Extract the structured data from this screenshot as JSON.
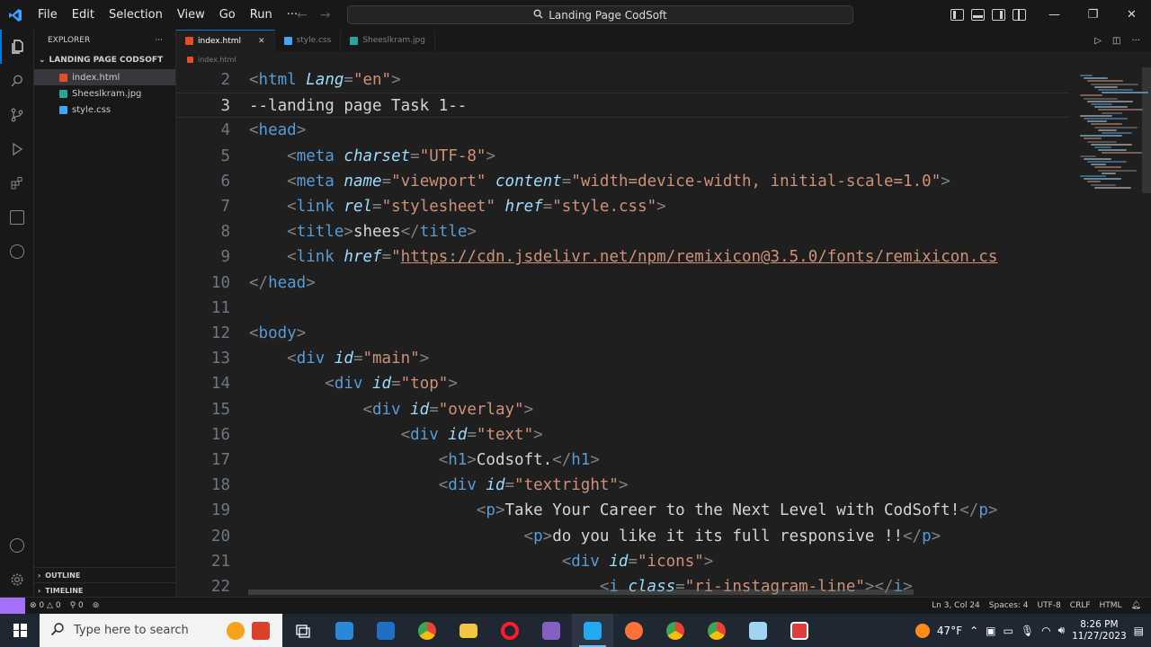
{
  "window": {
    "menu": [
      "File",
      "Edit",
      "Selection",
      "View",
      "Go",
      "Run",
      "···"
    ],
    "search_title": "Landing Page CodSoft"
  },
  "explorer": {
    "title": "EXPLORER",
    "more": "···",
    "folder": "LANDING PAGE CODSOFT",
    "files": [
      {
        "name": "index.html",
        "color": "#e44d26"
      },
      {
        "name": "Sheeslkram.jpg",
        "color": "#26a69a"
      },
      {
        "name": "style.css",
        "color": "#42a5f5"
      }
    ],
    "outline": "OUTLINE",
    "timeline": "TIMELINE"
  },
  "tabs": [
    {
      "label": "index.html",
      "close": "✕"
    },
    {
      "label": "style.css"
    },
    {
      "label": "Sheeslkram.jpg"
    }
  ],
  "breadcrumb": "index.html",
  "editor": {
    "lines": [
      {
        "n": "2",
        "indent": "",
        "tokens": [
          [
            "p",
            "<"
          ],
          [
            "tag",
            "html"
          ],
          [
            "text",
            " "
          ],
          [
            "attr",
            "Lang"
          ],
          [
            "p",
            "="
          ],
          [
            "str",
            "\"en\""
          ],
          [
            "p",
            ">"
          ]
        ]
      },
      {
        "n": "3",
        "indent": "",
        "current": true,
        "tokens": [
          [
            "text",
            "--landing page Task 1--"
          ]
        ]
      },
      {
        "n": "4",
        "indent": "",
        "tokens": [
          [
            "p",
            "<"
          ],
          [
            "tag",
            "head"
          ],
          [
            "p",
            ">"
          ]
        ]
      },
      {
        "n": "5",
        "indent": "    ",
        "tokens": [
          [
            "p",
            "<"
          ],
          [
            "tag",
            "meta"
          ],
          [
            "text",
            " "
          ],
          [
            "attr",
            "charset"
          ],
          [
            "p",
            "="
          ],
          [
            "str",
            "\"UTF-8\""
          ],
          [
            "p",
            ">"
          ]
        ]
      },
      {
        "n": "6",
        "indent": "    ",
        "tokens": [
          [
            "p",
            "<"
          ],
          [
            "tag",
            "meta"
          ],
          [
            "text",
            " "
          ],
          [
            "attr",
            "name"
          ],
          [
            "p",
            "="
          ],
          [
            "str",
            "\"viewport\""
          ],
          [
            "text",
            " "
          ],
          [
            "attr",
            "content"
          ],
          [
            "p",
            "="
          ],
          [
            "str",
            "\"width=device-width, initial-scale=1.0\""
          ],
          [
            "p",
            ">"
          ]
        ]
      },
      {
        "n": "7",
        "indent": "    ",
        "tokens": [
          [
            "p",
            "<"
          ],
          [
            "tag",
            "link"
          ],
          [
            "text",
            " "
          ],
          [
            "attr",
            "rel"
          ],
          [
            "p",
            "="
          ],
          [
            "str",
            "\"stylesheet\""
          ],
          [
            "text",
            " "
          ],
          [
            "attr",
            "href"
          ],
          [
            "p",
            "="
          ],
          [
            "str",
            "\"style.css\""
          ],
          [
            "p",
            ">"
          ]
        ]
      },
      {
        "n": "8",
        "indent": "    ",
        "tokens": [
          [
            "p",
            "<"
          ],
          [
            "tag",
            "title"
          ],
          [
            "p",
            ">"
          ],
          [
            "text",
            "shees"
          ],
          [
            "p",
            "</"
          ],
          [
            "tag",
            "title"
          ],
          [
            "p",
            ">"
          ]
        ]
      },
      {
        "n": "9",
        "indent": "    ",
        "tokens": [
          [
            "p",
            "<"
          ],
          [
            "tag",
            "link"
          ],
          [
            "text",
            " "
          ],
          [
            "attr",
            "href"
          ],
          [
            "p",
            "="
          ],
          [
            "str",
            "\""
          ],
          [
            "link",
            "https://cdn.jsdelivr.net/npm/remixicon@3.5.0/fonts/remixicon.cs"
          ]
        ]
      },
      {
        "n": "10",
        "indent": "",
        "tokens": [
          [
            "p",
            "</"
          ],
          [
            "tag",
            "head"
          ],
          [
            "p",
            ">"
          ]
        ]
      },
      {
        "n": "11",
        "indent": "",
        "tokens": []
      },
      {
        "n": "12",
        "indent": "",
        "tokens": [
          [
            "p",
            "<"
          ],
          [
            "tag",
            "body"
          ],
          [
            "p",
            ">"
          ]
        ]
      },
      {
        "n": "13",
        "indent": "    ",
        "tokens": [
          [
            "p",
            "<"
          ],
          [
            "tag",
            "div"
          ],
          [
            "text",
            " "
          ],
          [
            "attr",
            "id"
          ],
          [
            "p",
            "="
          ],
          [
            "str",
            "\"main\""
          ],
          [
            "p",
            ">"
          ]
        ]
      },
      {
        "n": "14",
        "indent": "        ",
        "tokens": [
          [
            "p",
            "<"
          ],
          [
            "tag",
            "div"
          ],
          [
            "text",
            " "
          ],
          [
            "attr",
            "id"
          ],
          [
            "p",
            "="
          ],
          [
            "str",
            "\"top\""
          ],
          [
            "p",
            ">"
          ]
        ]
      },
      {
        "n": "15",
        "indent": "            ",
        "tokens": [
          [
            "p",
            "<"
          ],
          [
            "tag",
            "div"
          ],
          [
            "text",
            " "
          ],
          [
            "attr",
            "id"
          ],
          [
            "p",
            "="
          ],
          [
            "str",
            "\"overlay\""
          ],
          [
            "p",
            ">"
          ]
        ]
      },
      {
        "n": "16",
        "indent": "                ",
        "tokens": [
          [
            "p",
            "<"
          ],
          [
            "tag",
            "div"
          ],
          [
            "text",
            " "
          ],
          [
            "attr",
            "id"
          ],
          [
            "p",
            "="
          ],
          [
            "str",
            "\"text\""
          ],
          [
            "p",
            ">"
          ]
        ]
      },
      {
        "n": "17",
        "indent": "                    ",
        "tokens": [
          [
            "p",
            "<"
          ],
          [
            "tag",
            "h1"
          ],
          [
            "p",
            ">"
          ],
          [
            "text",
            "Codsoft."
          ],
          [
            "p",
            "</"
          ],
          [
            "tag",
            "h1"
          ],
          [
            "p",
            ">"
          ]
        ]
      },
      {
        "n": "18",
        "indent": "                    ",
        "tokens": [
          [
            "p",
            "<"
          ],
          [
            "tag",
            "div"
          ],
          [
            "text",
            " "
          ],
          [
            "attr",
            "id"
          ],
          [
            "p",
            "="
          ],
          [
            "str",
            "\"textright\""
          ],
          [
            "p",
            ">"
          ]
        ]
      },
      {
        "n": "19",
        "indent": "                        ",
        "tokens": [
          [
            "p",
            "<"
          ],
          [
            "tag",
            "p"
          ],
          [
            "p",
            ">"
          ],
          [
            "text",
            "Take Your Career to the Next Level with CodSoft!"
          ],
          [
            "p",
            "</"
          ],
          [
            "tag",
            "p"
          ],
          [
            "p",
            ">"
          ]
        ]
      },
      {
        "n": "20",
        "indent": "                             ",
        "tokens": [
          [
            "p",
            "<"
          ],
          [
            "tag",
            "p"
          ],
          [
            "p",
            ">"
          ],
          [
            "text",
            "do you like it its full responsive !!"
          ],
          [
            "p",
            "</"
          ],
          [
            "tag",
            "p"
          ],
          [
            "p",
            ">"
          ]
        ]
      },
      {
        "n": "21",
        "indent": "                                 ",
        "tokens": [
          [
            "p",
            "<"
          ],
          [
            "tag",
            "div"
          ],
          [
            "text",
            " "
          ],
          [
            "attr",
            "id"
          ],
          [
            "p",
            "="
          ],
          [
            "str",
            "\"icons\""
          ],
          [
            "p",
            ">"
          ]
        ]
      },
      {
        "n": "22",
        "indent": "                                     ",
        "tokens": [
          [
            "p",
            "<"
          ],
          [
            "tag",
            "i"
          ],
          [
            "text",
            " "
          ],
          [
            "attr",
            "class"
          ],
          [
            "p",
            "="
          ],
          [
            "str",
            "\"ri-instagram-line\""
          ],
          [
            "p",
            ">"
          ],
          [
            "p",
            "</"
          ],
          [
            "tag",
            "i"
          ],
          [
            "p",
            ">"
          ]
        ]
      }
    ]
  },
  "status": {
    "errors": "0",
    "warnings": "0",
    "ports": "0",
    "position": "Ln 3, Col 24",
    "spaces": "Spaces: 4",
    "encoding": "UTF-8",
    "eol": "CRLF",
    "language": "HTML"
  },
  "taskbar": {
    "search_placeholder": "Type here to search",
    "weather": "47°F",
    "time": "8:26 PM",
    "date": "11/27/2023"
  },
  "colors": {
    "accent": "#0078d4",
    "remote": "#a371f7",
    "tag": "#569cd6",
    "attr": "#9cdcfe",
    "string": "#ce9178"
  }
}
